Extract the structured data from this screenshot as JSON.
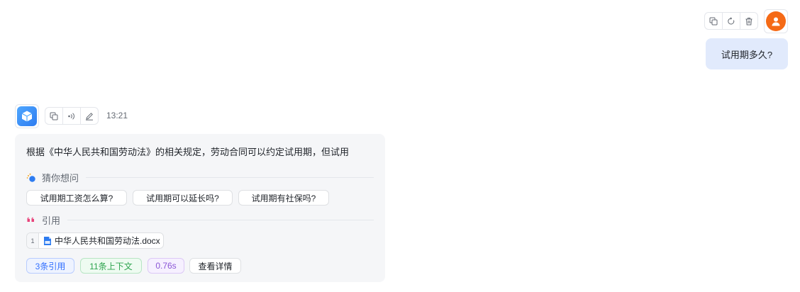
{
  "user_message": {
    "text": "试用期多久?",
    "actions": [
      "copy-icon",
      "refresh-icon",
      "trash-icon"
    ]
  },
  "bot_message": {
    "time": "13:21",
    "actions": [
      "copy-icon",
      "voice-icon",
      "edit-icon"
    ],
    "answer": "根据《中华人民共和国劳动法》的相关规定，劳动合同可以约定试用期，但试用",
    "guess_title": "猜你想问",
    "suggested_questions": [
      "试用期工资怎么算?",
      "试用期可以延长吗?",
      "试用期有社保吗?"
    ],
    "citation_title": "引用",
    "citations": [
      {
        "index": "1",
        "name": "中华人民共和国劳动法.docx"
      }
    ],
    "tags": {
      "cites": "3条引用",
      "context": "11条上下文",
      "time": "0.76s",
      "detail": "查看详情"
    }
  },
  "colors": {
    "user_bubble": "#e1eafc",
    "user_avatar": "#f56a16",
    "bot_avatar": "#2e7cf0",
    "card_bg": "#f5f6f8",
    "quote_icon": "#e8437a"
  }
}
